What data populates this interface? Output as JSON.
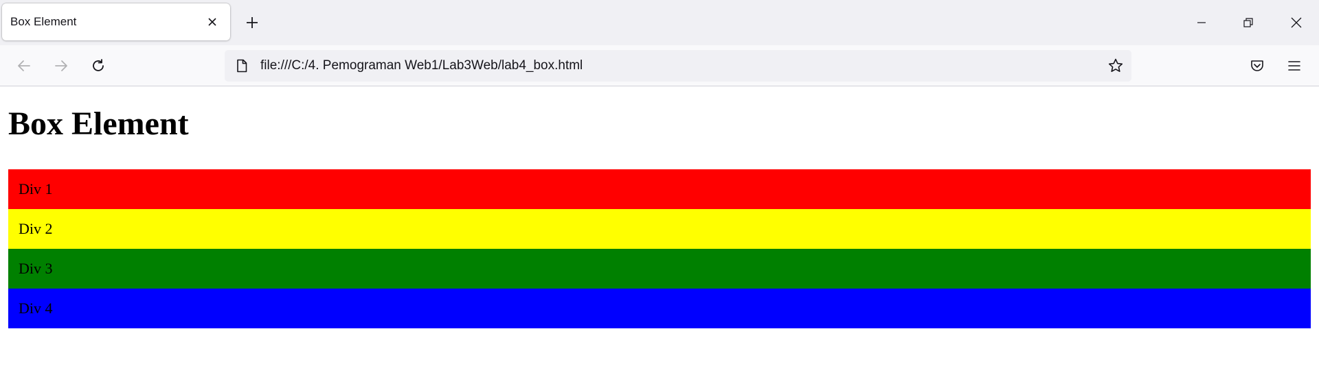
{
  "browser": {
    "tab": {
      "title": "Box Element"
    },
    "address_bar": {
      "url": "file:///C:/4. Pemograman Web1/Lab3Web/lab4_box.html"
    }
  },
  "page": {
    "heading": "Box Element",
    "boxes": [
      {
        "label": "Div 1",
        "color": "#ff0000"
      },
      {
        "label": "Div 2",
        "color": "#ffff00"
      },
      {
        "label": "Div 3",
        "color": "#008000"
      },
      {
        "label": "Div 4",
        "color": "#0000ff"
      }
    ]
  },
  "icons": {
    "tab_close": "close-icon",
    "new_tab": "plus-icon",
    "minimize": "minimize-icon",
    "restore": "restore-icon",
    "window_close": "close-icon",
    "back": "arrow-left-icon",
    "forward": "arrow-right-icon",
    "reload": "reload-icon",
    "page": "page-icon",
    "bookmark": "star-icon",
    "pocket": "pocket-icon",
    "menu": "hamburger-menu-icon"
  }
}
